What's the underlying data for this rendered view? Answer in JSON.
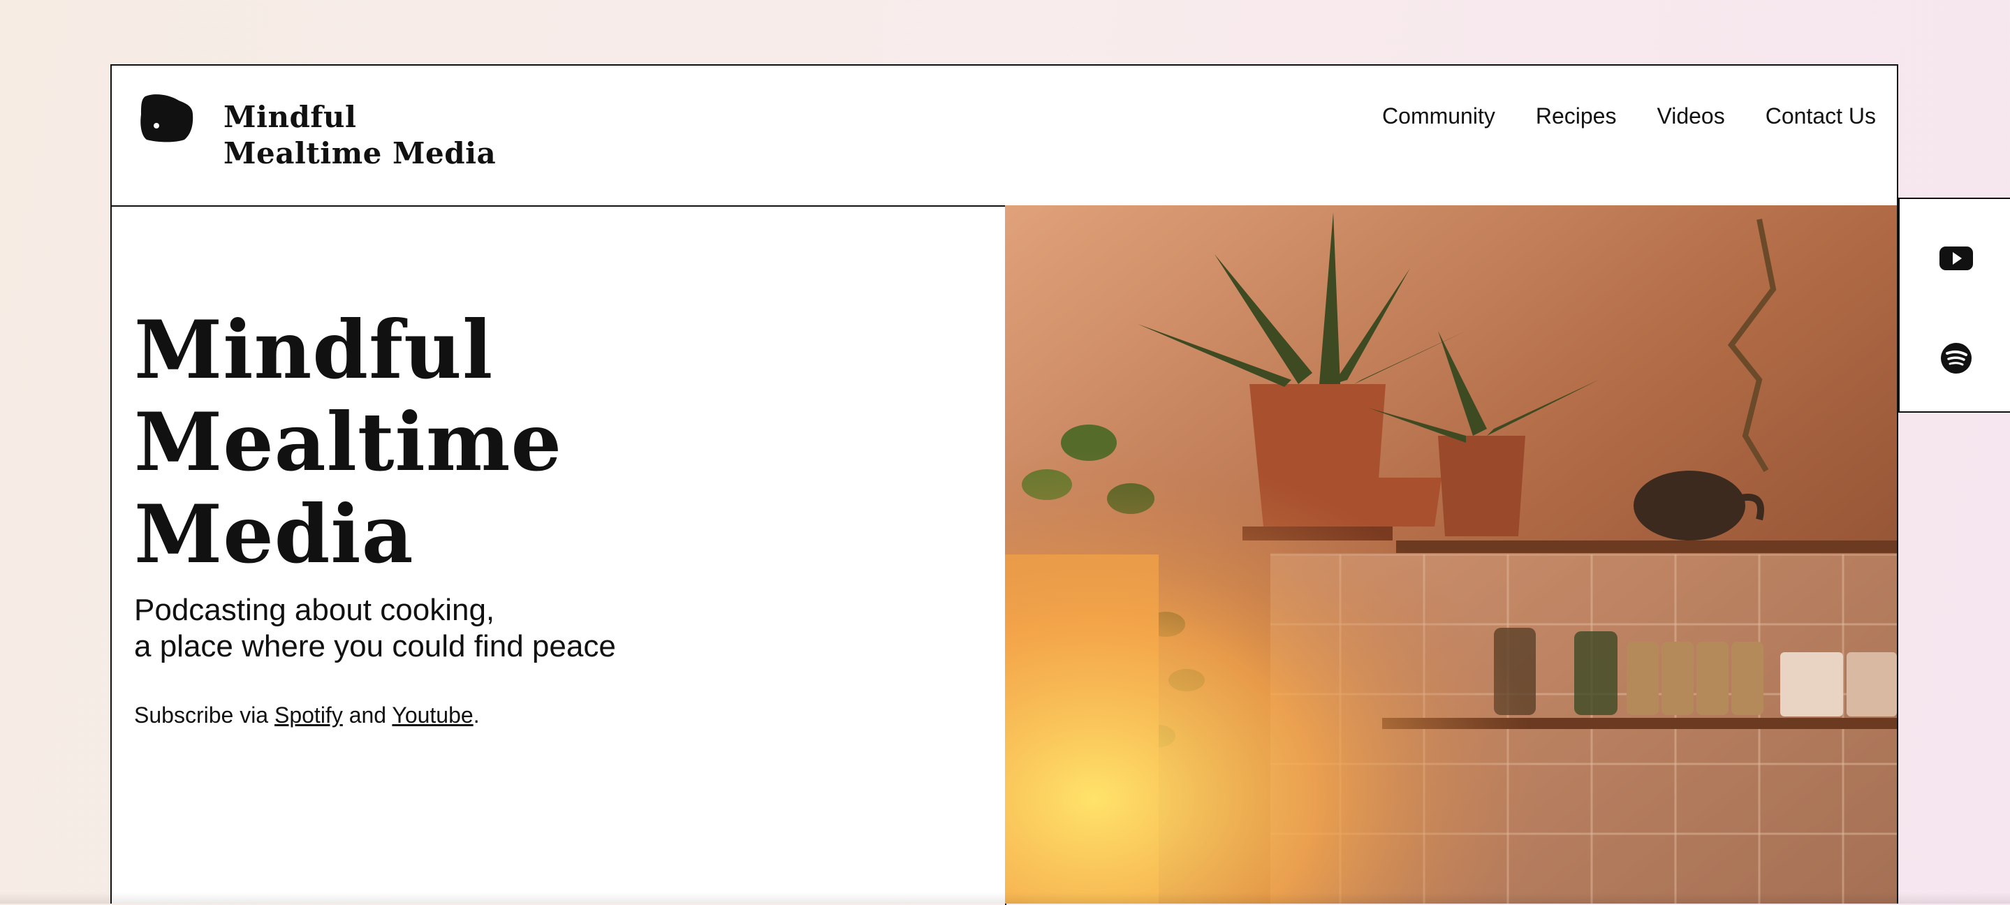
{
  "header": {
    "brand": "Mindful Mealtime Media",
    "logo_icon": "black-blob-logo-icon",
    "nav": [
      {
        "label": "Community"
      },
      {
        "label": "Recipes"
      },
      {
        "label": "Videos"
      },
      {
        "label": "Contact Us"
      }
    ]
  },
  "hero": {
    "title_lines": [
      "Mindful",
      "Mealtime",
      "Media"
    ],
    "tagline_lines": [
      "Podcasting about cooking,",
      "a place where you could find peace"
    ],
    "subscribe": {
      "prefix": "Subscribe via ",
      "spotify_link": "Spotify",
      "middle": " and ",
      "youtube_link": "Youtube",
      "suffix": "."
    },
    "image": "kitchen-shelves-plants-photo"
  },
  "social": {
    "youtube_icon": "youtube-icon",
    "spotify_icon": "spotify-icon"
  },
  "colors": {
    "text": "#111111",
    "frame_border": "#111111",
    "page_background": "#f7ebea"
  }
}
